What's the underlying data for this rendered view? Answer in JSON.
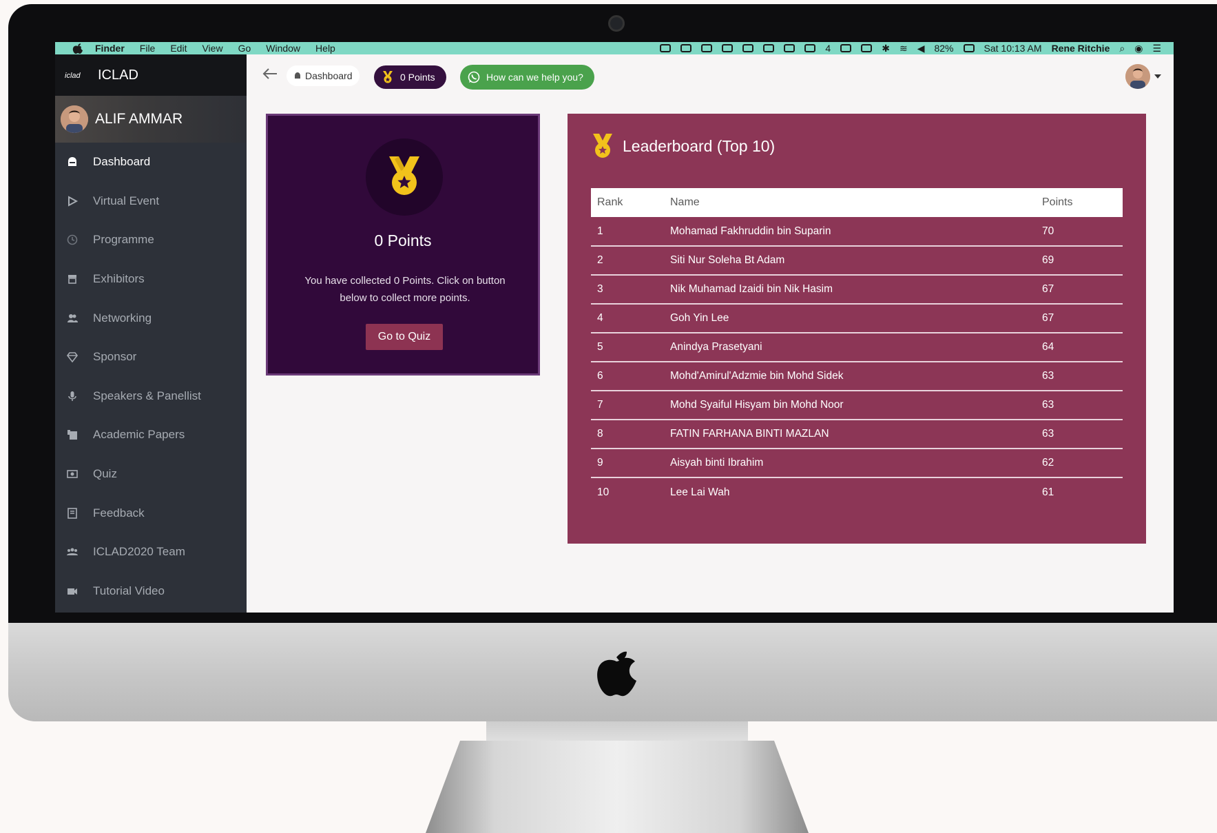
{
  "menubar": {
    "items": [
      "Finder",
      "File",
      "Edit",
      "View",
      "Go",
      "Window",
      "Help"
    ],
    "battery": "82%",
    "clock": "Sat 10:13 AM",
    "user": "Rene Ritchie",
    "status_count": "4"
  },
  "app": {
    "title": "ICLAD",
    "logo_text": "iclad"
  },
  "profile": {
    "name": "ALIF AMMAR"
  },
  "sidebar": {
    "items": [
      {
        "label": "Dashboard",
        "icon": "dashboard-icon"
      },
      {
        "label": "Virtual Event",
        "icon": "play-icon"
      },
      {
        "label": "Programme",
        "icon": "clock-icon"
      },
      {
        "label": "Exhibitors",
        "icon": "store-icon"
      },
      {
        "label": "Networking",
        "icon": "users-icon"
      },
      {
        "label": "Sponsor",
        "icon": "diamond-icon"
      },
      {
        "label": "Speakers & Panellist",
        "icon": "microphone-icon"
      },
      {
        "label": "Academic Papers",
        "icon": "papers-icon"
      },
      {
        "label": "Quiz",
        "icon": "quiz-icon"
      },
      {
        "label": "Feedback",
        "icon": "feedback-icon"
      },
      {
        "label": "ICLAD2020 Team",
        "icon": "team-icon"
      },
      {
        "label": "Tutorial Video",
        "icon": "video-icon"
      }
    ]
  },
  "topbar": {
    "breadcrumb": "Dashboard",
    "points_label": "0 Points",
    "help_label": "How can we help you?"
  },
  "points_card": {
    "title": "0 Points",
    "text": "You have collected 0 Points. Click on button below to collect more points.",
    "button": "Go to Quiz"
  },
  "leaderboard": {
    "title": "Leaderboard (Top 10)",
    "columns": [
      "Rank",
      "Name",
      "Points"
    ],
    "rows": [
      {
        "rank": "1",
        "name": "Mohamad Fakhruddin bin Suparin",
        "points": "70"
      },
      {
        "rank": "2",
        "name": "Siti Nur Soleha Bt Adam",
        "points": "69"
      },
      {
        "rank": "3",
        "name": "Nik Muhamad Izaidi bin Nik Hasim",
        "points": "67"
      },
      {
        "rank": "4",
        "name": "Goh Yin Lee",
        "points": "67"
      },
      {
        "rank": "5",
        "name": "Anindya Prasetyani",
        "points": "64"
      },
      {
        "rank": "6",
        "name": "Mohd'Amirul'Adzmie bin Mohd Sidek",
        "points": "63"
      },
      {
        "rank": "7",
        "name": "Mohd Syaiful Hisyam bin Mohd Noor",
        "points": "63"
      },
      {
        "rank": "8",
        "name": "FATIN FARHANA BINTI MAZLAN",
        "points": "63"
      },
      {
        "rank": "9",
        "name": "Aisyah binti Ibrahim",
        "points": "62"
      },
      {
        "rank": "10",
        "name": "Lee Lai Wah",
        "points": "61"
      }
    ]
  },
  "colors": {
    "sidebar": "#2d3139",
    "points_card": "#31093a",
    "leaderboard": "#8c3656",
    "accent_gold": "#f2c21b",
    "help_green": "#4aa24c",
    "menubar": "#7fd8c4"
  }
}
